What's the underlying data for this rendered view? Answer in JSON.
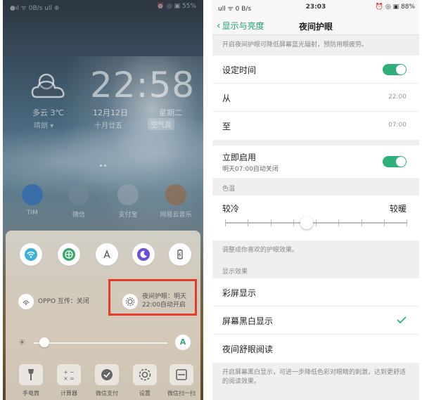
{
  "left": {
    "status_left": "●ıl ᯤ 0B/s ull ⊕",
    "status_right": "⏰ ◎ ▣ 55%",
    "weather": "多云 3℃",
    "weather_sub": "晴朗 ▾",
    "clock": "22:58",
    "date": "12月12日",
    "weekday": "星期二",
    "lunar": "十月廿五",
    "aqi": "空气良",
    "apps": [
      {
        "label": "TIM"
      },
      {
        "label": "微信"
      },
      {
        "label": "支付宝"
      },
      {
        "label": "网易云音乐"
      }
    ],
    "control": {
      "oppo_share": "OPPO 互传：关闭",
      "night_mode_line1": "夜间护眼：明天",
      "night_mode_line2": "22:00自动开启",
      "auto_brightness": "A",
      "brightness_level": 0.08,
      "shortcuts": [
        {
          "label": "手电筒"
        },
        {
          "label": "计算器"
        },
        {
          "label": "微信支付"
        },
        {
          "label": "设置"
        },
        {
          "label": "微信扫一扫"
        }
      ]
    }
  },
  "right": {
    "status_left": "ull ᯤ 0 B/s",
    "status_time": "23:03",
    "status_right": "⏰ ◎ ▣ 88%",
    "back_label": "显示与亮度",
    "title": "夜间护眼",
    "intro": "开启夜间护眼可降低屏幕蓝光辐射，预防用眼疲劳。",
    "schedule_label": "设定时间",
    "schedule_on": true,
    "from_label": "从",
    "from_value": "22:00",
    "to_label": "至",
    "to_value": "07:00",
    "enable_now_label": "立即启用",
    "enable_now_sub": "明天07:00自动关闭",
    "enable_now_on": true,
    "color_temp_title": "色温",
    "cool_label": "较冷",
    "warm_label": "较暖",
    "color_temp_level": 0.45,
    "color_temp_hint": "调整成你喜欢的护眼效果。",
    "effect_title": "显示效果",
    "effects": [
      {
        "label": "彩屏显示",
        "selected": false
      },
      {
        "label": "屏幕黑白显示",
        "selected": true
      },
      {
        "label": "夜间舒眼阅读",
        "selected": false
      }
    ],
    "footer_hint": "开启屏幕黑白显示，可进一步降低色彩对眼睛的刺激，达到更舒适的阅读效果。",
    "accent": "#2faf7a"
  }
}
